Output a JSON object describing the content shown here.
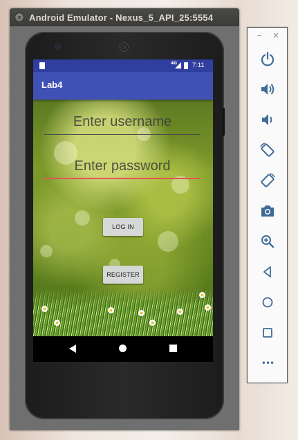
{
  "window": {
    "title": "Android Emulator - Nexus_5_API_25:5554",
    "close_glyph": "×"
  },
  "status_bar": {
    "network": "4G",
    "time": "7:11"
  },
  "app": {
    "title": "Lab4",
    "username_placeholder": "Enter username",
    "password_placeholder": "Enter password",
    "login_label": "LOG IN",
    "register_label": "REGISTER"
  },
  "toolbar": {
    "minimize": "–",
    "close": "×",
    "more": "•••",
    "icons": [
      "power-icon",
      "volume-up-icon",
      "volume-down-icon",
      "rotate-left-icon",
      "rotate-right-icon",
      "camera-icon",
      "zoom-icon",
      "back-icon",
      "home-icon",
      "overview-icon",
      "more-icon"
    ]
  },
  "colors": {
    "status_bar": "#303f9f",
    "app_bar": "#3f51b5",
    "toolbar_icon": "#3f6c97",
    "field_accent": "#e5525b"
  }
}
